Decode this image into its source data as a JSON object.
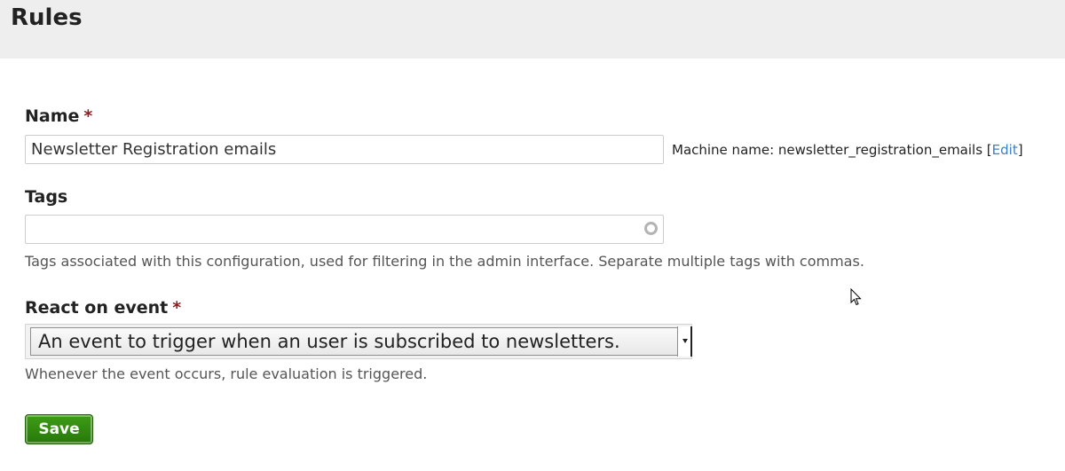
{
  "header": {
    "title": "Rules"
  },
  "form": {
    "name": {
      "label": "Name",
      "required_marker": "*",
      "value": "Newsletter Registration emails",
      "machine_name_prefix": "Machine name: newsletter_registration_emails ",
      "bracket_open": "[",
      "edit_label": "Edit",
      "bracket_close": "]"
    },
    "tags": {
      "label": "Tags",
      "value": "",
      "description": "Tags associated with this configuration, used for filtering in the admin interface. Separate multiple tags with commas."
    },
    "event": {
      "label": "React on event",
      "required_marker": "*",
      "selected": "An event to trigger when an user is subscribed to newsletters.",
      "description": "Whenever the event occurs, rule evaluation is triggered."
    },
    "save_label": "Save"
  },
  "icons": {
    "autocomplete": "autocomplete-throbber-icon",
    "select_arrow": "chevron-down-icon",
    "cursor": "mouse-pointer-icon"
  },
  "colors": {
    "header_bg": "#eeeeee",
    "required": "#8c1e1e",
    "link": "#3b7fc4",
    "save_button": "#3e9c16"
  }
}
